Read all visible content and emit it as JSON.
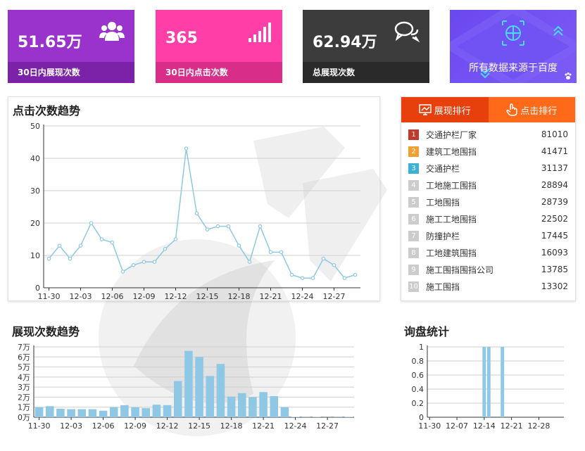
{
  "cards": [
    {
      "value": "51.65万",
      "label": "30日内展现次数",
      "icon": "users-icon"
    },
    {
      "value": "365",
      "label": "30日内点击次数",
      "icon": "signal-bars-icon"
    },
    {
      "value": "62.94万",
      "label": "总展现次数",
      "icon": "chat-bubbles-icon"
    }
  ],
  "source_card": {
    "text": "所有数据来源于百度"
  },
  "click_trend": {
    "title": "点击次数趋势"
  },
  "impression_trend": {
    "title": "展现次数趋势"
  },
  "inquiry": {
    "title": "询盘统计"
  },
  "rank": {
    "tab_impressions": "展现排行",
    "tab_clicks": "点击排行",
    "rank_colors": [
      "#c0392b",
      "#f0a030",
      "#3bb0d8"
    ],
    "items": [
      {
        "rank": "1",
        "name": "交通护栏厂家",
        "value": "81010"
      },
      {
        "rank": "2",
        "name": "建筑工地围挡",
        "value": "41471"
      },
      {
        "rank": "3",
        "name": "交通护栏",
        "value": "31137"
      },
      {
        "rank": "4",
        "name": "工地施工围挡",
        "value": "28894"
      },
      {
        "rank": "5",
        "name": "工地围挡",
        "value": "28739"
      },
      {
        "rank": "6",
        "name": "施工工地围挡",
        "value": "22502"
      },
      {
        "rank": "7",
        "name": "防撞护栏",
        "value": "17445"
      },
      {
        "rank": "8",
        "name": "工地建筑围挡",
        "value": "16093"
      },
      {
        "rank": "9",
        "name": "施工围挡围挡公司",
        "value": "13785"
      },
      {
        "rank": "10",
        "name": "施工围挡",
        "value": "13302"
      }
    ]
  },
  "chart_data": [
    {
      "type": "line",
      "title": "点击次数趋势",
      "color": "#8ec8e4",
      "x_ticks": [
        "11-30",
        "12-03",
        "12-06",
        "12-09",
        "12-12",
        "12-15",
        "12-18",
        "12-21",
        "12-24",
        "12-27"
      ],
      "ylim": [
        0,
        50
      ],
      "y_ticks": [
        "0",
        "10",
        "20",
        "30",
        "40",
        "50"
      ],
      "values": [
        9,
        13,
        9,
        13,
        20,
        15,
        14,
        5,
        7,
        8,
        8,
        12,
        15,
        43,
        23,
        18,
        19,
        19,
        13,
        8,
        19,
        11,
        11,
        4,
        3,
        3,
        9,
        7,
        3,
        4
      ],
      "grid": true
    },
    {
      "type": "bar",
      "title": "展现次数趋势",
      "color": "#8ec8e4",
      "x_ticks": [
        "11-30",
        "12-03",
        "12-06",
        "12-09",
        "12-12",
        "12-15",
        "12-18",
        "12-21",
        "12-24",
        "12-27"
      ],
      "ylim": [
        0,
        70000
      ],
      "y_ticks": [
        "0万",
        "1万",
        "2万",
        "3万",
        "4万",
        "5万",
        "6万",
        "7万"
      ],
      "values": [
        10000,
        11000,
        8500,
        8000,
        8000,
        8000,
        6500,
        10000,
        12000,
        10000,
        9000,
        12500,
        12000,
        36000,
        66000,
        60000,
        41000,
        53000,
        20500,
        24000,
        20000,
        25000,
        21000,
        10000,
        400,
        200,
        300,
        100,
        200,
        400
      ],
      "grid": true
    },
    {
      "type": "bar",
      "title": "询盘统计",
      "color": "#8ec8e4",
      "x_ticks": [
        "11-30",
        "12-07",
        "12-14",
        "12-21",
        "12-28"
      ],
      "ylim": [
        0,
        1
      ],
      "y_ticks": [
        "0",
        "0.2",
        "0.4",
        "0.6",
        "0.8",
        "1"
      ],
      "values": [
        0,
        0,
        0,
        0,
        0,
        0,
        0,
        0,
        0,
        0,
        0,
        0,
        1,
        1,
        0,
        0,
        1,
        0,
        0,
        0,
        0,
        0,
        0,
        0,
        0,
        0,
        0,
        0,
        0,
        0
      ],
      "grid": true
    }
  ]
}
